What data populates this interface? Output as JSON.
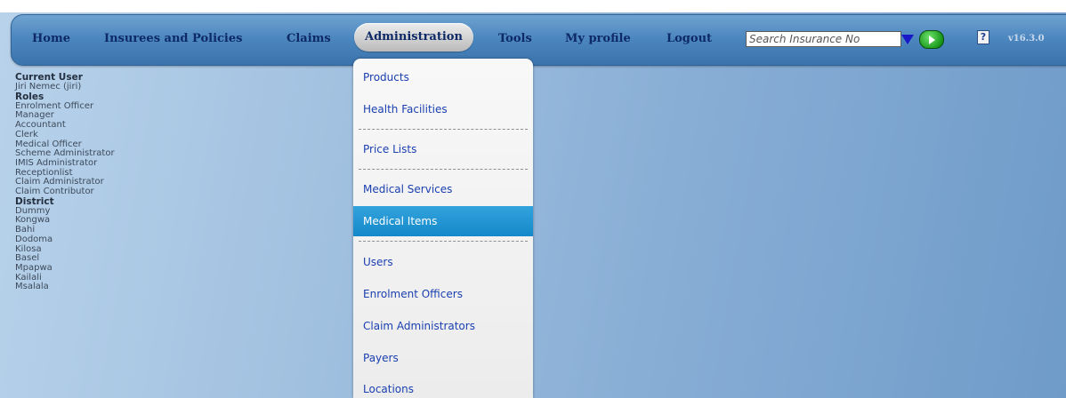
{
  "nav": {
    "items": [
      {
        "label": "Home"
      },
      {
        "label": "Insurees and Policies"
      },
      {
        "label": "Claims"
      },
      {
        "label": "Administration",
        "active": true
      },
      {
        "label": "Tools"
      },
      {
        "label": "My profile"
      },
      {
        "label": "Logout"
      }
    ],
    "search_placeholder": "Search Insurance No",
    "help_label": "?",
    "version": "v16.3.0"
  },
  "sidebar": {
    "current_user_heading": "Current User",
    "current_user": "Jiri Nemec (jiri)",
    "roles_heading": "Roles",
    "roles": [
      "Enrolment Officer",
      "Manager",
      "Accountant",
      "Clerk",
      "Medical Officer",
      "Scheme Administrator",
      "IMIS Administrator",
      "Receptionlist",
      "Claim Administrator",
      "Claim Contributor"
    ],
    "district_heading": "District",
    "districts": [
      "Dummy",
      "Kongwa",
      "Bahi",
      "Dodoma",
      "Kilosa",
      "Basel",
      "Mpapwa",
      "Kailali",
      "Msalala"
    ]
  },
  "dropdown": {
    "items": [
      "Products",
      "Health Facilities",
      "Price Lists",
      "Medical Services",
      "Medical Items",
      "Users",
      "Enrolment Officers",
      "Claim Administrators",
      "Payers",
      "Locations"
    ],
    "highlighted": "Medical Items"
  },
  "colors": {
    "nav_text": "#0d2a66",
    "menu_link": "#1a3fb0",
    "menu_highlight": "#1488c9",
    "search_go": "#1b9a1b",
    "search_arrow": "#1818c8"
  }
}
